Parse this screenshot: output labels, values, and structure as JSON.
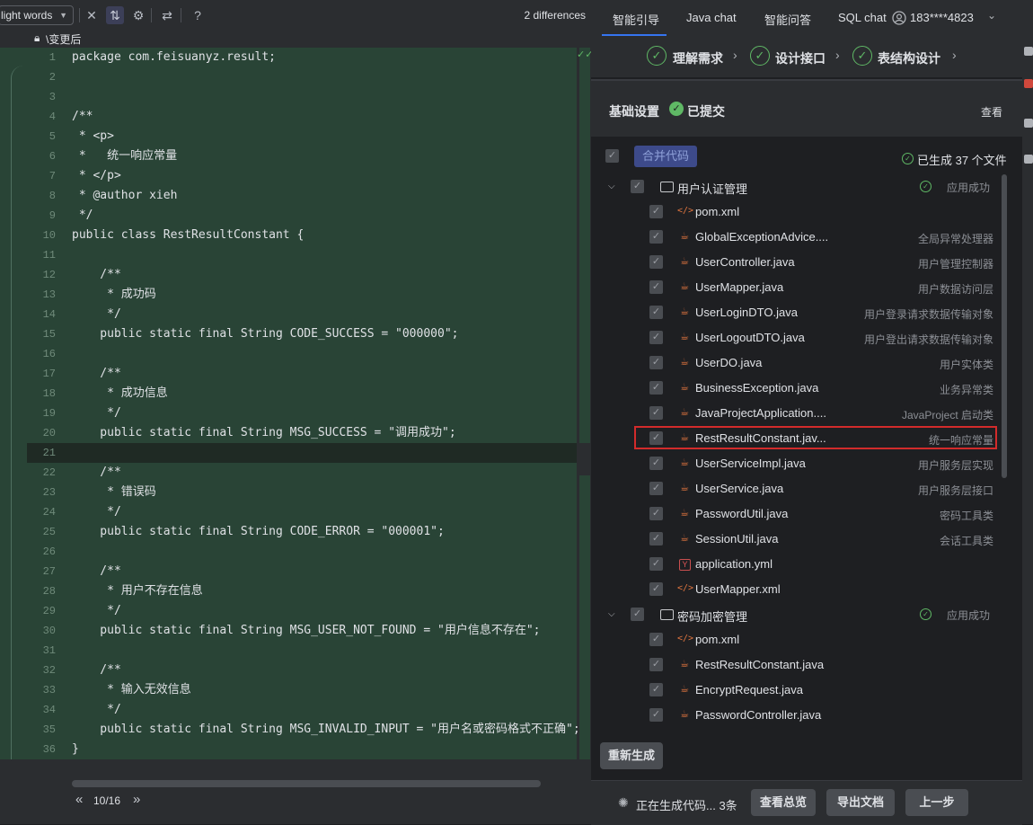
{
  "editor": {
    "highlight_words_label": "light words",
    "diff_count": "2 differences",
    "path": "\\变更后",
    "pager": "10/16",
    "lines": [
      {
        "n": "1",
        "text": "package com.feisuanyz.result;"
      },
      {
        "n": "2",
        "text": ""
      },
      {
        "n": "3",
        "text": ""
      },
      {
        "n": "4",
        "text": "/**"
      },
      {
        "n": "5",
        "text": " * <p>"
      },
      {
        "n": "6",
        "text": " *   统一响应常量"
      },
      {
        "n": "7",
        "text": " * </p>"
      },
      {
        "n": "8",
        "text": " * @author xieh"
      },
      {
        "n": "9",
        "text": " */"
      },
      {
        "n": "10",
        "text": "public class RestResultConstant {"
      },
      {
        "n": "11",
        "text": ""
      },
      {
        "n": "12",
        "text": "    /**"
      },
      {
        "n": "13",
        "text": "     * 成功码"
      },
      {
        "n": "14",
        "text": "     */"
      },
      {
        "n": "15",
        "text": "    public static final String CODE_SUCCESS = \"000000\";"
      },
      {
        "n": "16",
        "text": ""
      },
      {
        "n": "17",
        "text": "    /**"
      },
      {
        "n": "18",
        "text": "     * 成功信息"
      },
      {
        "n": "19",
        "text": "     */"
      },
      {
        "n": "20",
        "text": "    public static final String MSG_SUCCESS = \"调用成功\";"
      },
      {
        "n": "21",
        "text": ""
      },
      {
        "n": "22",
        "text": "    /**"
      },
      {
        "n": "23",
        "text": "     * 错误码"
      },
      {
        "n": "24",
        "text": "     */"
      },
      {
        "n": "25",
        "text": "    public static final String CODE_ERROR = \"000001\";"
      },
      {
        "n": "26",
        "text": ""
      },
      {
        "n": "27",
        "text": "    /**"
      },
      {
        "n": "28",
        "text": "     * 用户不存在信息"
      },
      {
        "n": "29",
        "text": "     */"
      },
      {
        "n": "30",
        "text": "    public static final String MSG_USER_NOT_FOUND = \"用户信息不存在\";"
      },
      {
        "n": "31",
        "text": ""
      },
      {
        "n": "32",
        "text": "    /**"
      },
      {
        "n": "33",
        "text": "     * 输入无效信息"
      },
      {
        "n": "34",
        "text": "     */"
      },
      {
        "n": "35",
        "text": "    public static final String MSG_INVALID_INPUT = \"用户名或密码格式不正确\";"
      },
      {
        "n": "36",
        "text": "}"
      }
    ]
  },
  "panel": {
    "tabs": [
      "智能引导",
      "Java chat",
      "智能问答",
      "SQL chat"
    ],
    "account": "183****4823",
    "steps": [
      "理解需求",
      "设计接口",
      "表结构设计"
    ],
    "basic_settings": "基础设置",
    "submitted": "已提交",
    "view": "查看",
    "merge_code": "合并代码",
    "generated_count": "已生成 37 个文件",
    "groups": [
      {
        "name": "用户认证管理",
        "status": "应用成功",
        "files": [
          {
            "name": "pom.xml",
            "desc": "",
            "type": "xml"
          },
          {
            "name": "GlobalExceptionAdvice....",
            "desc": "全局异常处理器",
            "type": "java"
          },
          {
            "name": "UserController.java",
            "desc": "用户管理控制器",
            "type": "java"
          },
          {
            "name": "UserMapper.java",
            "desc": "用户数据访问层",
            "type": "java"
          },
          {
            "name": "UserLoginDTO.java",
            "desc": "用户登录请求数据传输对象",
            "type": "java"
          },
          {
            "name": "UserLogoutDTO.java",
            "desc": "用户登出请求数据传输对象",
            "type": "java"
          },
          {
            "name": "UserDO.java",
            "desc": "用户实体类",
            "type": "java"
          },
          {
            "name": "BusinessException.java",
            "desc": "业务异常类",
            "type": "java"
          },
          {
            "name": "JavaProjectApplication....",
            "desc": "JavaProject 启动类",
            "type": "java"
          },
          {
            "name": "RestResultConstant.jav...",
            "desc": "统一响应常量",
            "type": "java"
          },
          {
            "name": "UserServiceImpl.java",
            "desc": "用户服务层实现",
            "type": "java"
          },
          {
            "name": "UserService.java",
            "desc": "用户服务层接口",
            "type": "java"
          },
          {
            "name": "PasswordUtil.java",
            "desc": "密码工具类",
            "type": "java"
          },
          {
            "name": "SessionUtil.java",
            "desc": "会话工具类",
            "type": "java"
          },
          {
            "name": "application.yml",
            "desc": "",
            "type": "yml"
          },
          {
            "name": "UserMapper.xml",
            "desc": "",
            "type": "xml"
          }
        ]
      },
      {
        "name": "密码加密管理",
        "status": "应用成功",
        "files": [
          {
            "name": "pom.xml",
            "desc": "",
            "type": "xml"
          },
          {
            "name": "RestResultConstant.java",
            "desc": "",
            "type": "java"
          },
          {
            "name": "EncryptRequest.java",
            "desc": "",
            "type": "java"
          },
          {
            "name": "PasswordController.java",
            "desc": "",
            "type": "java"
          }
        ]
      }
    ],
    "regenerate": "重新生成",
    "gen_status": "正在生成代码... 3条",
    "btn_overview": "查看总览",
    "btn_export": "导出文档",
    "btn_prev": "上一步"
  }
}
